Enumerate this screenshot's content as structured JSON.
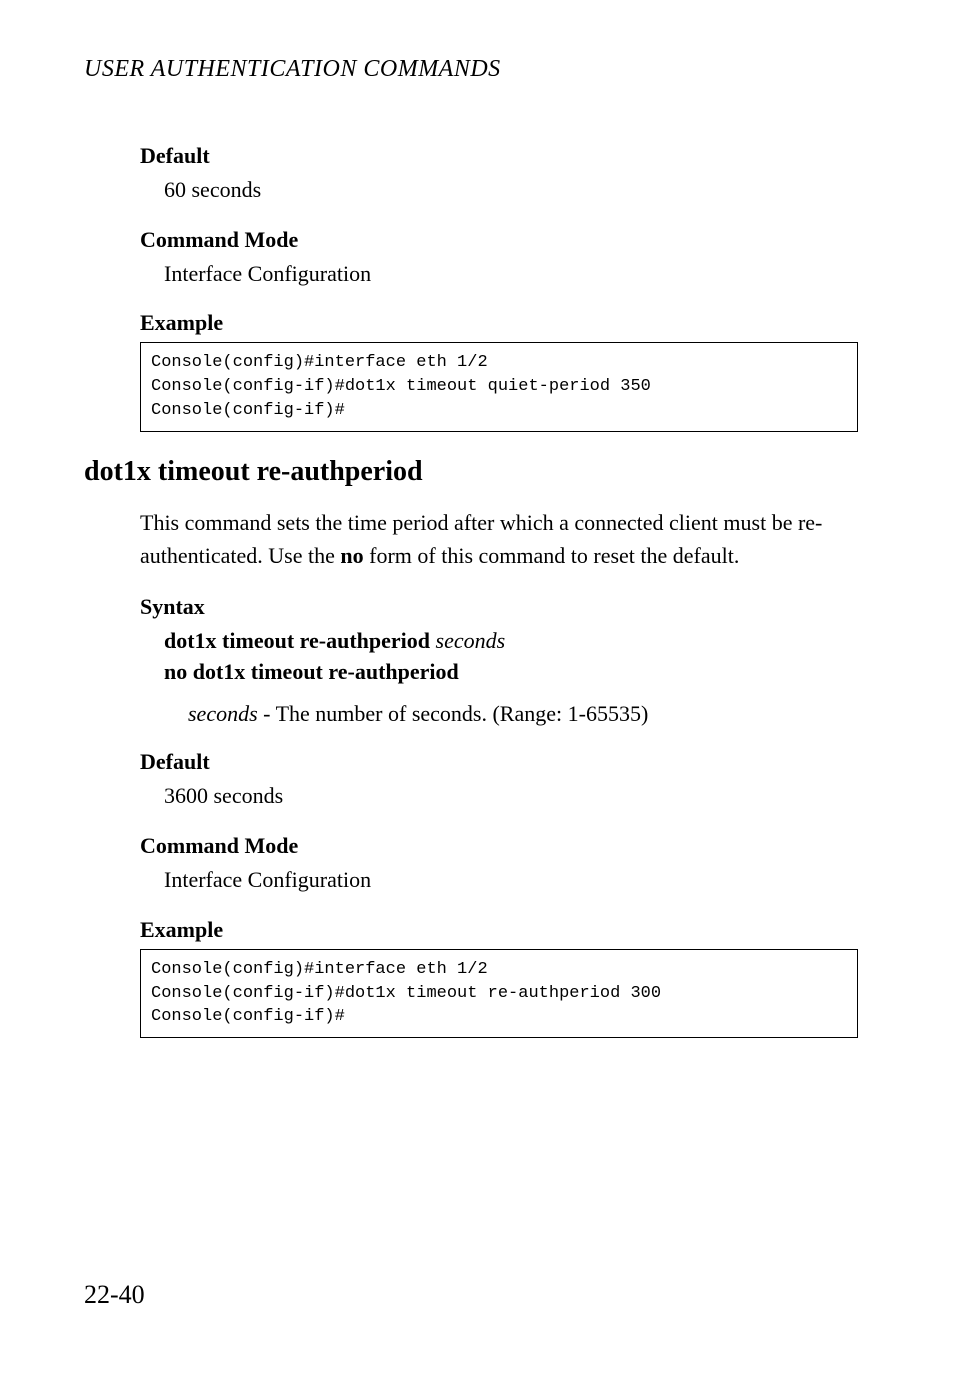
{
  "running_head": "USER AUTHENTICATION COMMANDS",
  "sec1": {
    "default_h": "Default",
    "default_v": "60 seconds",
    "mode_h": "Command Mode",
    "mode_v": "Interface Configuration",
    "example_h": "Example",
    "code": "Console(config)#interface eth 1/2\nConsole(config-if)#dot1x timeout quiet-period 350\nConsole(config-if)#"
  },
  "cmd": {
    "title": "dot1x timeout re-authperiod",
    "desc_pre": "This command sets the time period after which a connected client must be re-authenticated. Use the ",
    "desc_bold": "no",
    "desc_post": " form of this command to reset the default.",
    "syntax_h": "Syntax",
    "syntax_l1_bold": "dot1x timeout re-authperiod ",
    "syntax_l1_italic": "seconds",
    "syntax_l2": "no dot1x timeout re-authperiod",
    "param_italic": "seconds",
    "param_rest": " - The number of seconds. (Range: 1-65535)",
    "default_h": "Default",
    "default_v": "3600 seconds",
    "mode_h": "Command Mode",
    "mode_v": "Interface Configuration",
    "example_h": "Example",
    "code": "Console(config)#interface eth 1/2\nConsole(config-if)#dot1x timeout re-authperiod 300\nConsole(config-if)#"
  },
  "page_number": "22-40"
}
